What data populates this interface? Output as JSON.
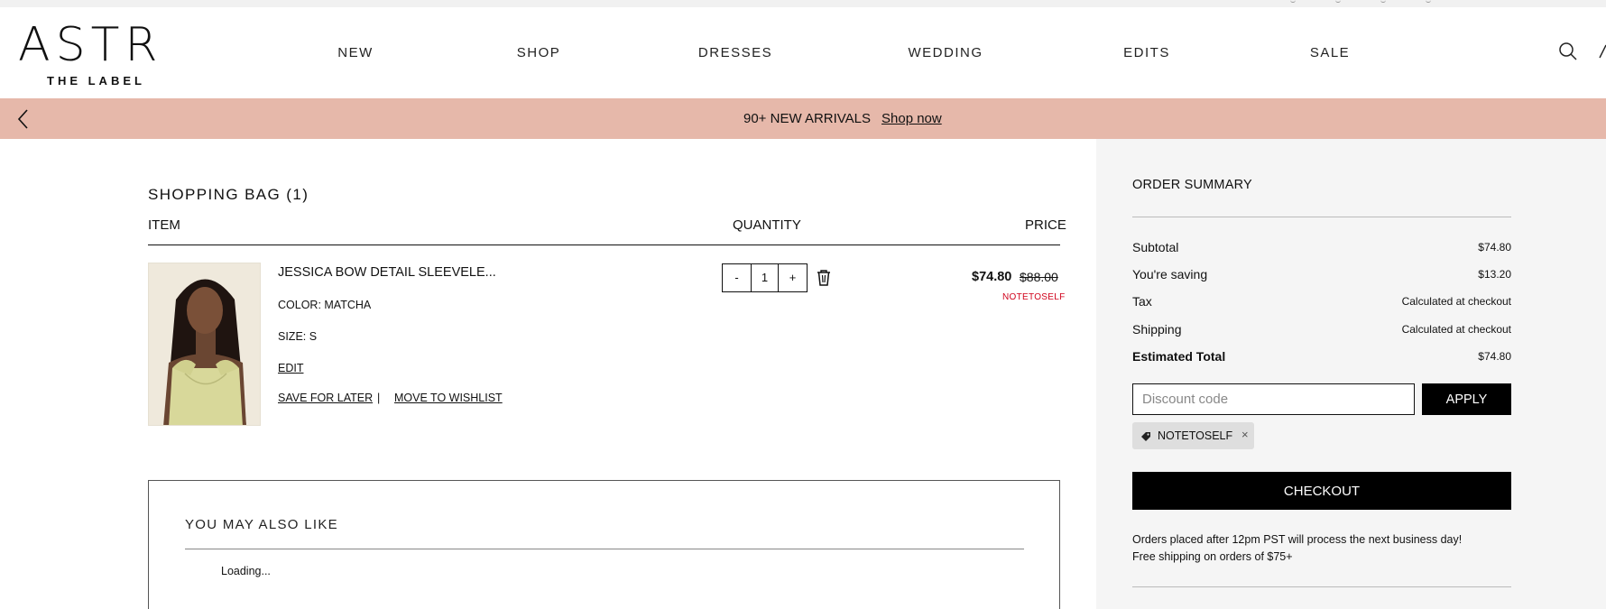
{
  "brand": {
    "logo_main": "ASTR",
    "logo_sub": "THE LABEL"
  },
  "nav": {
    "items": [
      "NEW",
      "SHOP",
      "DRESSES",
      "WEDDING",
      "EDITS",
      "SALE"
    ]
  },
  "icons": {
    "search": "search-icon",
    "account": "account-icon",
    "back": "chevron-left-icon",
    "trash": "trash-icon",
    "tag": "tag-icon",
    "remove": "close-icon"
  },
  "promo": {
    "text": "90+ NEW ARRIVALS",
    "link": "Shop now",
    "color": "#e6b8aa"
  },
  "bag": {
    "title": "SHOPPING BAG (1)",
    "columns": {
      "item": "ITEM",
      "quantity": "QUANTITY",
      "price": "PRICE"
    },
    "item": {
      "name": "JESSICA BOW DETAIL SLEEVELE...",
      "color": "COLOR: MATCHA",
      "size": "SIZE: S",
      "edit": "EDIT",
      "save_for_later": "SAVE FOR LATER",
      "separator": "|",
      "move_to_wishlist": "MOVE TO WISHLIST",
      "qty_minus": "-",
      "quantity": "1",
      "qty_plus": "+",
      "price": "$74.80",
      "original_price": "$88.00",
      "promo_code": "NOTETOSELF"
    }
  },
  "recommendations": {
    "title": "YOU MAY ALSO LIKE",
    "loading": "Loading..."
  },
  "summary": {
    "title": "ORDER SUMMARY",
    "rows": [
      {
        "label": "Subtotal",
        "value": "$74.80"
      },
      {
        "label": "You're saving",
        "value": "$13.20"
      },
      {
        "label": "Tax",
        "value": "Calculated at checkout"
      },
      {
        "label": "Shipping",
        "value": "Calculated at checkout"
      },
      {
        "label": "Estimated Total",
        "value": "$74.80"
      }
    ],
    "discount_placeholder": "Discount code",
    "apply": "APPLY",
    "applied_code": "NOTETOSELF",
    "remove": "×",
    "checkout": "CHECKOUT",
    "notes": [
      "Orders placed after 12pm PST will process the next business day!",
      "Free shipping on orders of $75+"
    ]
  },
  "colors": {
    "accent": "#000000",
    "sale_red": "#d0021b",
    "summary_bg": "#f5f5f5"
  }
}
